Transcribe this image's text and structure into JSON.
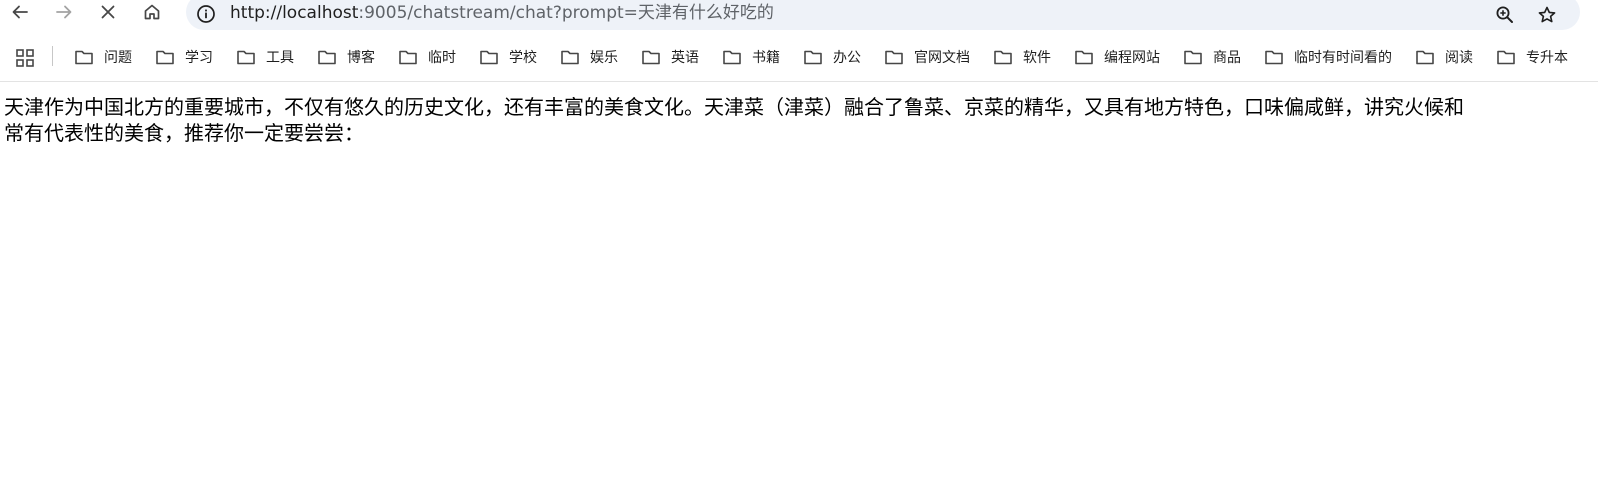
{
  "browser": {
    "url_host": "http://localhost",
    "url_rest": ":9005/chatstream/chat?prompt=天津有什么好吃的",
    "icons": {
      "back": "arrow-left-icon",
      "forward": "arrow-right-icon",
      "stop": "close-icon",
      "home": "home-icon",
      "site_info": "info-icon",
      "zoom": "zoom-in-icon",
      "bookmark": "star-icon",
      "apps": "apps-grid-icon",
      "folder": "folder-icon"
    }
  },
  "bookmarks": [
    {
      "label": "问题"
    },
    {
      "label": "学习"
    },
    {
      "label": "工具"
    },
    {
      "label": "博客"
    },
    {
      "label": "临时"
    },
    {
      "label": "学校"
    },
    {
      "label": "娱乐"
    },
    {
      "label": "英语"
    },
    {
      "label": "书籍"
    },
    {
      "label": "办公"
    },
    {
      "label": "官网文档"
    },
    {
      "label": "软件"
    },
    {
      "label": "编程网站"
    },
    {
      "label": "商品"
    },
    {
      "label": "临时有时间看的"
    },
    {
      "label": "阅读"
    },
    {
      "label": "专升本"
    }
  ],
  "page": {
    "line1": "天津作为中国北方的重要城市，不仅有悠久的历史文化，还有丰富的美食文化。天津菜（津菜）融合了鲁菜、京菜的精华，又具有地方特色，口味偏咸鲜，讲究火候和",
    "line2": "常有代表性的美食，推荐你一定要尝尝："
  }
}
